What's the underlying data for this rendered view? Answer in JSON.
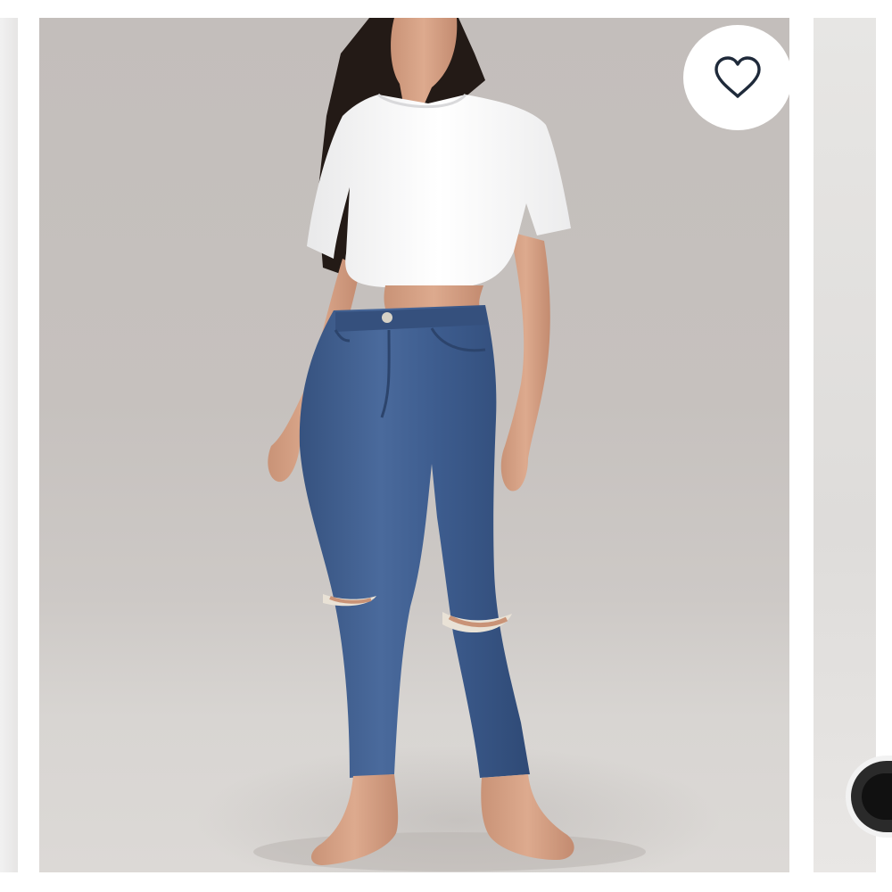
{
  "product_carousel": {
    "current_image_description_alt": "",
    "favorite": {
      "icon": "heart-outline-icon",
      "state": "not-favorited"
    }
  },
  "colors": {
    "photo_backdrop": "#c5c0bd",
    "heart_stroke": "#1f2a3a",
    "denim": "#3e5d8f"
  }
}
